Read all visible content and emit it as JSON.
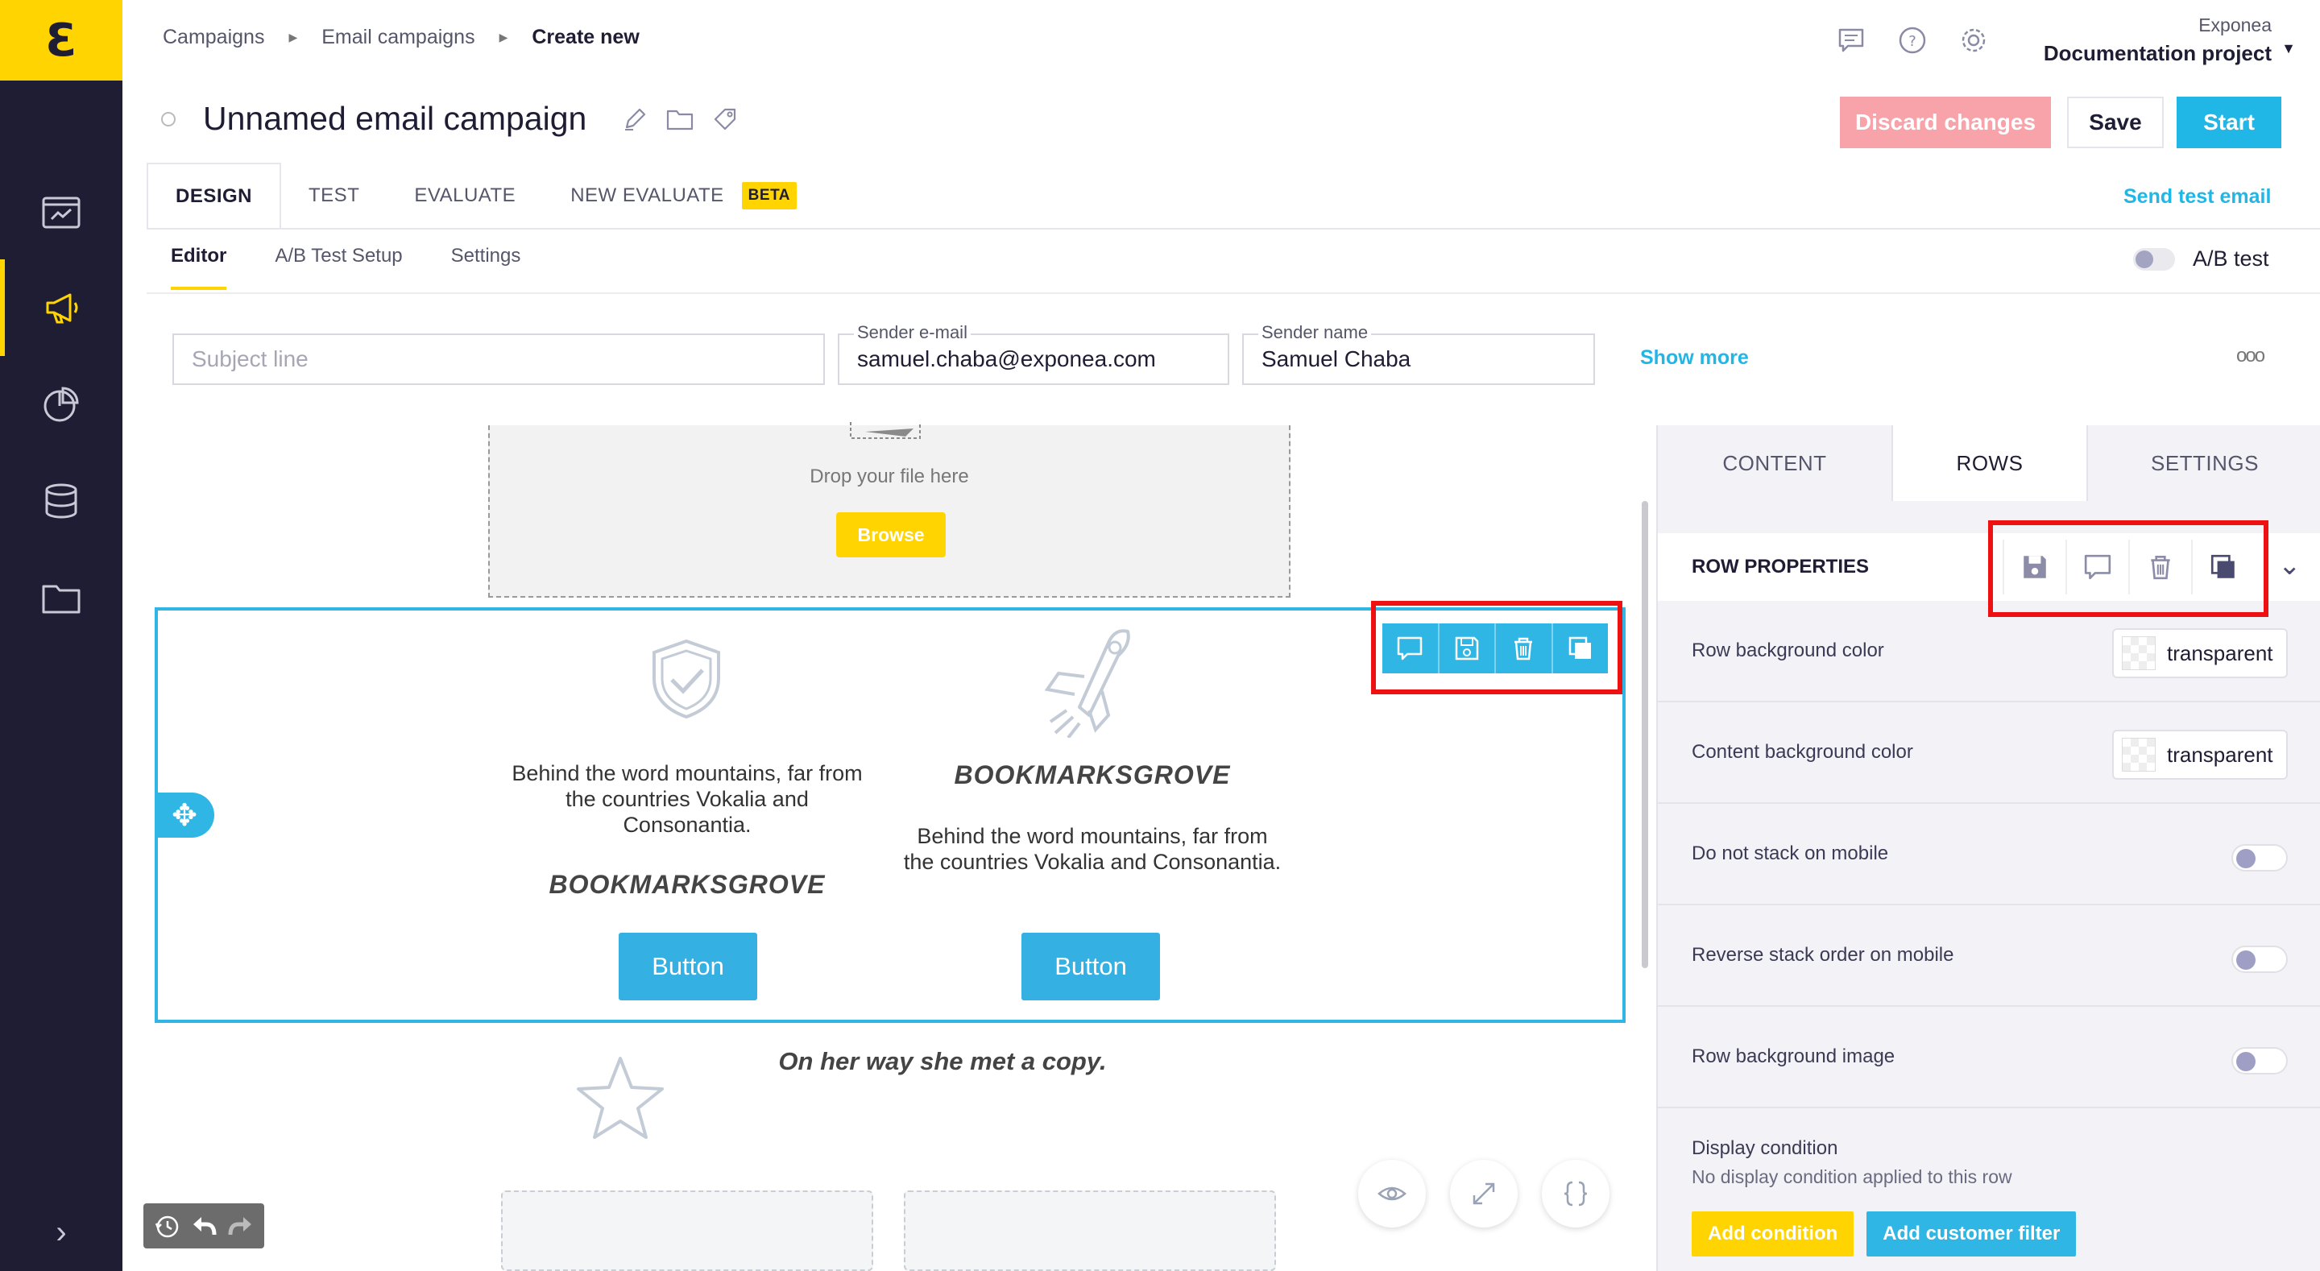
{
  "breadcrumb": {
    "items": [
      "Campaigns",
      "Email campaigns"
    ],
    "current": "Create new"
  },
  "project": {
    "org": "Exponea",
    "name": "Documentation project"
  },
  "campaign": {
    "title": "Unnamed email campaign"
  },
  "actions": {
    "discard": "Discard changes",
    "save": "Save",
    "start": "Start"
  },
  "tabs": {
    "design": "DESIGN",
    "test": "TEST",
    "evaluate": "EVALUATE",
    "new_evaluate": "NEW EVALUATE",
    "beta": "BETA",
    "send_test": "Send test email"
  },
  "subtabs": {
    "editor": "Editor",
    "ab_setup": "A/B Test Setup",
    "settings": "Settings",
    "ab_test": "A/B test"
  },
  "fields": {
    "subject_placeholder": "Subject line",
    "sender_email_label": "Sender e-mail",
    "sender_email": "samuel.chaba@exponea.com",
    "sender_name_label": "Sender name",
    "sender_name": "Samuel Chaba",
    "show_more": "Show more",
    "more": "ooo"
  },
  "canvas": {
    "drop_text": "Drop your file here",
    "browse": "Browse",
    "col1_text": "Behind the word mountains, far from the countries Vokalia and Consonantia.",
    "col1_title": "BOOKMARKSGROVE",
    "col1_button": "Button",
    "col2_title": "BOOKMARKSGROVE",
    "col2_text": "Behind the word mountains, far from the countries Vokalia and Consonantia.",
    "col2_button": "Button",
    "copy_text": "On her way she met a copy."
  },
  "panel": {
    "tabs": {
      "content": "CONTENT",
      "rows": "ROWS",
      "settings": "SETTINGS"
    },
    "header": "ROW PROPERTIES",
    "row_bg_label": "Row background color",
    "row_bg_value": "transparent",
    "content_bg_label": "Content background color",
    "content_bg_value": "transparent",
    "no_stack_label": "Do not stack on mobile",
    "reverse_label": "Reverse stack order on mobile",
    "bg_image_label": "Row background image",
    "display_title": "Display condition",
    "display_sub": "No display condition applied to this row",
    "add_condition": "Add condition",
    "add_filter": "Add customer filter"
  },
  "colors": {
    "accent": "#20b6e5",
    "brand": "#ffd400",
    "nav": "#1f1d34",
    "discard": "#f8a3aa",
    "highlight": "#ee1111"
  }
}
